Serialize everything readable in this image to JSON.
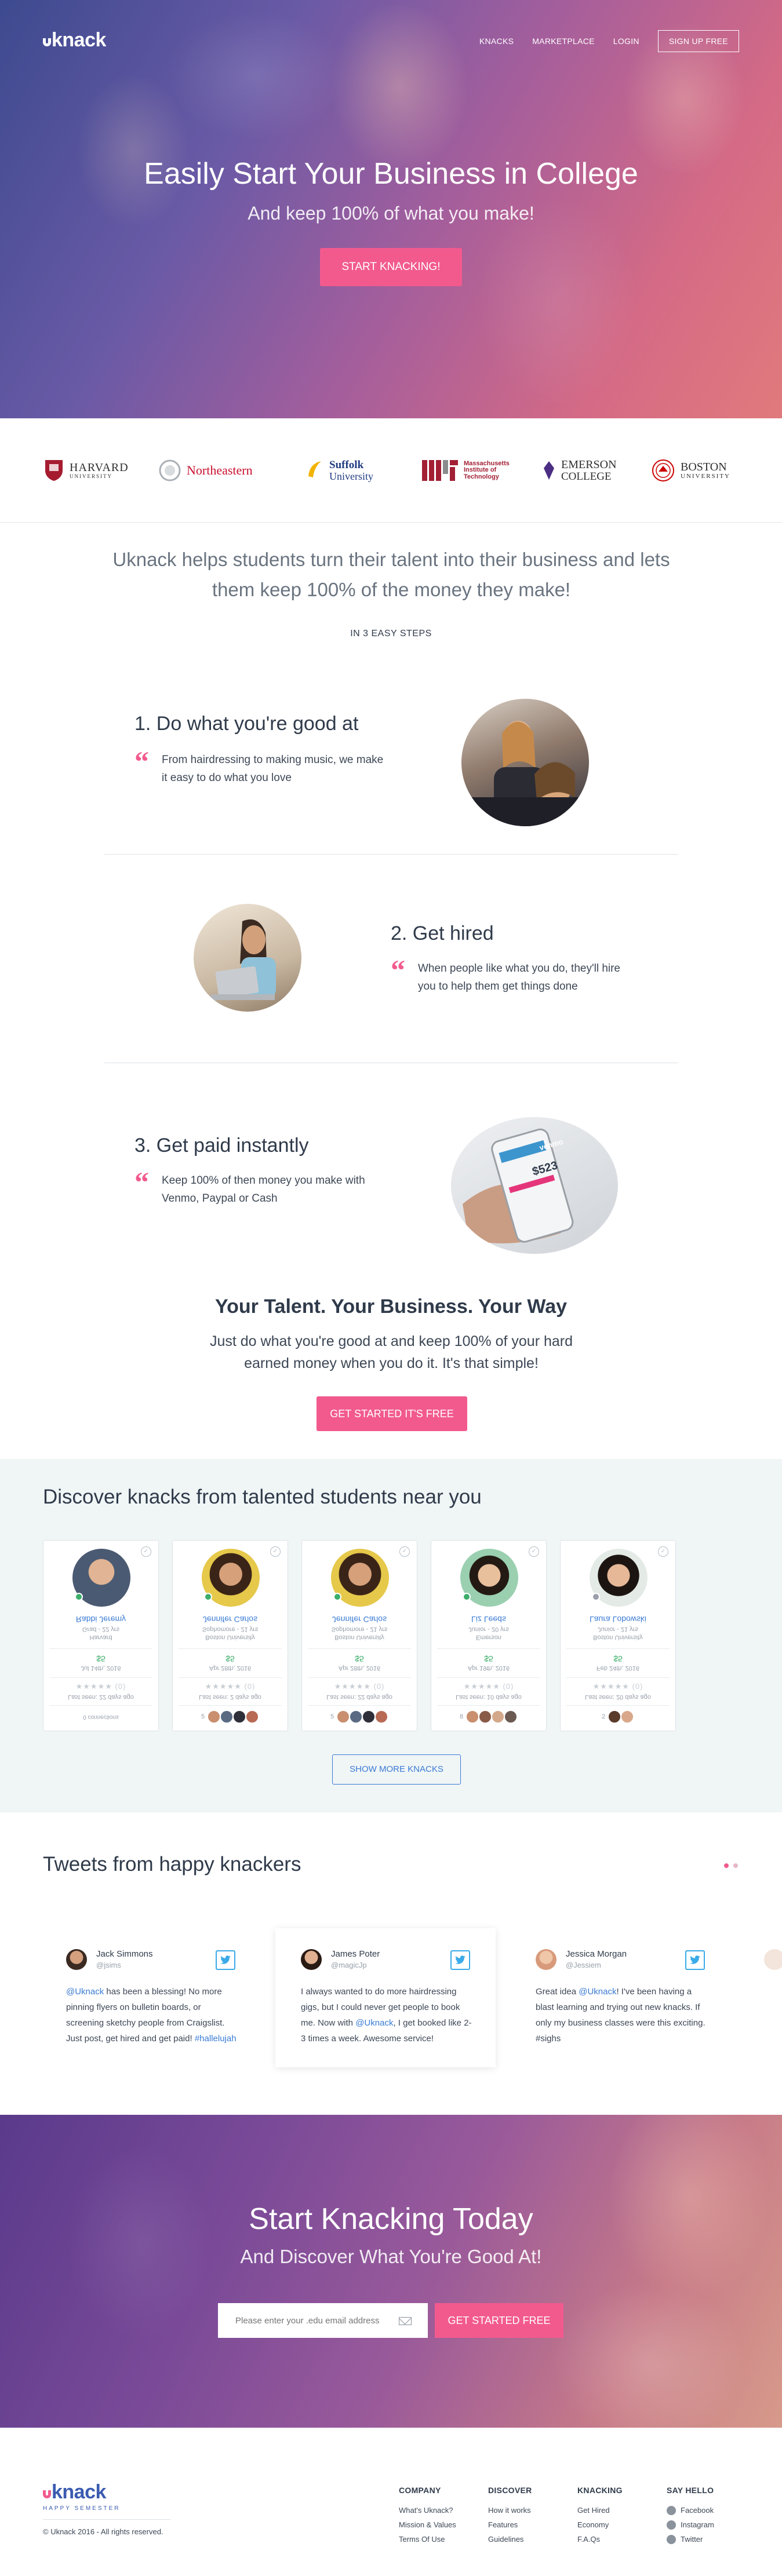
{
  "brand": {
    "name": "knack",
    "tagline": "HAPPY SEMESTER"
  },
  "nav": {
    "knacks": "KNACKS",
    "marketplace": "MARKETPLACE",
    "login": "LOGIN",
    "signup": "SIGN UP FREE"
  },
  "hero": {
    "title": "Easily Start Your Business in College",
    "subtitle": "And keep 100% of what you make!",
    "cta": "START KNACKING!"
  },
  "universities": [
    {
      "name": "HARVARD",
      "sub": "UNIVERSITY"
    },
    {
      "name": "Northeastern"
    },
    {
      "name": "Suffolk",
      "sub": "University"
    },
    {
      "name": "Massachusetts",
      "sub2": "Institute of",
      "sub3": "Technology"
    },
    {
      "name": "EMERSON",
      "sub": "COLLEGE"
    },
    {
      "name": "BOSTON",
      "sub": "UNIVERSITY"
    }
  ],
  "intro": "Uknack helps students turn their talent into their business and lets them keep 100% of the money they make!",
  "steps_label": "IN 3 EASY STEPS",
  "steps": [
    {
      "title": "1. Do what you're good at",
      "text": "From hairdressing to making music, we make it easy to do what you love"
    },
    {
      "title": "2. Get hired",
      "text": "When people like what you do, they'll hire you to help them get things done"
    },
    {
      "title": "3. Get paid instantly",
      "text": "Keep 100% of then money you make with Venmo, Paypal or Cash",
      "phone_brand": "venmo",
      "phone_amount": "$523"
    }
  ],
  "way": {
    "title": "Your Talent. Your Business. Your Way",
    "text": "Just do what you're good at and keep 100% of your hard earned money when you do it. It's that simple!",
    "cta": "GET STARTED IT'S FREE"
  },
  "discover": {
    "title": "Discover knacks from talented students near you",
    "cards": [
      {
        "name": "Rabbi Jeremy",
        "school": "Harvard",
        "sub": "Grad - 22 yrs",
        "price": "$5",
        "date": "Jul 14th, 2016",
        "rating": "(0)",
        "seen": "Last seen: 22 days ago",
        "footer": "0 connections"
      },
      {
        "name": "Jennifer Carlos",
        "school": "Boston University",
        "sub": "Sophomore - 21 yrs",
        "price": "$5",
        "date": "Apr 28th, 2016",
        "rating": "(0)",
        "seen": "Last seen: 2 days ago",
        "count": "5"
      },
      {
        "name": "Jennifer Carlos",
        "school": "Boston University",
        "sub": "Sophomore - 21 yrs",
        "price": "$5",
        "date": "Apr 28th, 2016",
        "rating": "(0)",
        "seen": "Last seen: 22 days ago",
        "count": "5"
      },
      {
        "name": "Liz Leeds",
        "school": "Emerson",
        "sub": "Junior - 20 yrs",
        "price": "$5",
        "date": "Apr 19th, 2016",
        "rating": "(0)",
        "seen": "Last seen: 10 days ago",
        "count": "8"
      },
      {
        "name": "Laura Lobowski",
        "school": "Boston University",
        "sub": "Junior - 21 yrs",
        "price": "$5",
        "date": "Feb 24th, 2016",
        "rating": "(0)",
        "seen": "Last seen: 20 days ago",
        "count": "2"
      }
    ],
    "show_more": "SHOW MORE KNACKS"
  },
  "tweets": {
    "title": "Tweets from happy knackers",
    "items": [
      {
        "name": "Jack Simmons",
        "handle": "@jsims",
        "pre": "",
        "mention": "@Uknack",
        "text": " has been a blessing! No more pinning flyers on bulletin boards, or screening sketchy people from Craigslist. Just post, get hired and get paid! ",
        "tag": "#hallelujah"
      },
      {
        "name": "James Poter",
        "handle": "@magicJp",
        "pre": "I always wanted to do more hairdressing gigs, but I could never get people to book me. Now with ",
        "mention": "@Uknack",
        "text": ", I get booked like 2-3 times a week. Awesome service!",
        "tag": ""
      },
      {
        "name": "Jessica Morgan",
        "handle": "@Jessiem",
        "pre": "Great idea ",
        "mention": "@Uknack",
        "text": "! I've been having a blast learning and trying out new knacks. If only my business classes were this exciting. #sighs",
        "tag": ""
      }
    ]
  },
  "bottom": {
    "title": "Start Knacking Today",
    "subtitle": "And Discover What You're Good At!",
    "placeholder": "Please enter your .edu email address",
    "cta": "GET STARTED FREE"
  },
  "footer": {
    "copyright": "© Uknack 2016 - All rights reserved.",
    "columns": [
      {
        "title": "COMPANY",
        "links": [
          "What's Uknack?",
          "Mission & Values",
          "Terms Of Use"
        ]
      },
      {
        "title": "DISCOVER",
        "links": [
          "How it works",
          "Features",
          "Guidelines"
        ]
      },
      {
        "title": "KNACKING",
        "links": [
          "Get Hired",
          "Economy",
          "F.A.Qs"
        ]
      },
      {
        "title": "SAY HELLO",
        "links": [
          "Facebook",
          "Instagram",
          "Twitter"
        ]
      }
    ]
  },
  "colors": {
    "accent": "#f25a8e",
    "link": "#3a7bd5",
    "text": "#2f3a4a"
  }
}
